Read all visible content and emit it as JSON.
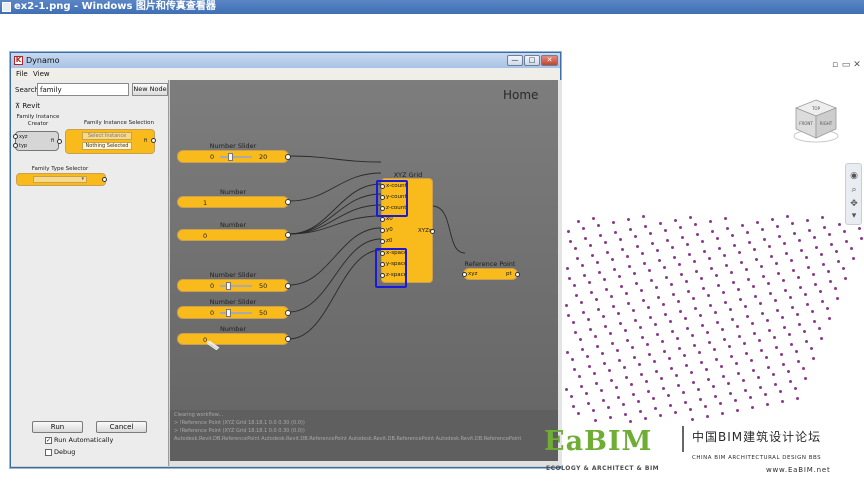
{
  "outer_window": {
    "title": "ex2-1.png - Windows 图片和传真查看器"
  },
  "dynamo": {
    "title": "Dynamo",
    "window_buttons": {
      "minimize": "—",
      "maximize": "□",
      "close": "✕"
    },
    "menu": [
      "File",
      "View"
    ],
    "search": {
      "label": "Search:",
      "value": "family"
    },
    "new_node_label": "New Node",
    "library": {
      "category": "Revit",
      "family_instance_creator": {
        "title": "Family Instance Creator",
        "ports": [
          "xyz",
          "typ"
        ],
        "output": "fi"
      },
      "family_instance_selection": {
        "title": "Family Instance Selection",
        "button": "Select Instance",
        "status": "Nothing Selected",
        "output": "fi"
      },
      "family_type_selector": {
        "title": "Family Type Selector"
      }
    },
    "run_label": "Run",
    "cancel_label": "Cancel",
    "run_automatically": {
      "label": "Run Automatically",
      "checked": true
    },
    "debug": {
      "label": "Debug",
      "checked": false
    },
    "canvas": {
      "home_label": "Home",
      "nodes": {
        "slider1": {
          "title": "Number Slider",
          "min": "0",
          "max": "20",
          "value": 0.3
        },
        "number1": {
          "title": "Number",
          "value": "1"
        },
        "number2": {
          "title": "Number",
          "value": "0"
        },
        "slider2": {
          "title": "Number Slider",
          "min": "0",
          "max": "50",
          "value": 0.25
        },
        "slider3": {
          "title": "Number Slider",
          "min": "0",
          "max": "50",
          "value": 0.25
        },
        "number3": {
          "title": "Number",
          "value": "0"
        },
        "xyz_grid": {
          "title": "XYZ Grid",
          "inputs": [
            "x-count",
            "y-count",
            "z-count",
            "x0",
            "y0",
            "z0",
            "x-space",
            "y-space",
            "z-space"
          ],
          "output": "XYZs"
        },
        "reference_point": {
          "title": "Reference Point",
          "input": "xyz",
          "output": "pt"
        }
      }
    },
    "console_lines": [
      "Clearing workflow...",
      "> !Reference Point (XYZ Grid 18.18.1 0.0 0.30 (0.0))",
      "> !Reference Point (XYZ Grid 18.18.1 0.0 0.30 (0.0))",
      "Autodesk.Revit.DB.ReferencePoint Autodesk.Revit.DB.ReferencePoint Autodesk.Revit.DB.ReferencePoint Autodesk.Revit.DB.ReferencePoint"
    ]
  },
  "watermark": {
    "logo": "EaBIM",
    "tagline": "ECOLOGY & ARCHITECT & BIM",
    "cn_name": "中国BIM建筑设计论坛",
    "en_name": "CHINA BIM ARCHITECTURAL DESIGN BBS",
    "url": "www.EaBIM.net"
  },
  "viewcube_labels": {
    "top": "TOP",
    "front": "FRONT",
    "right": "RIGHT"
  },
  "colors": {
    "node_fill": "#f9bb1c",
    "highlight": "#1a1ad8",
    "dot": "#8a3a8a",
    "logo_green": "#6fae35"
  }
}
